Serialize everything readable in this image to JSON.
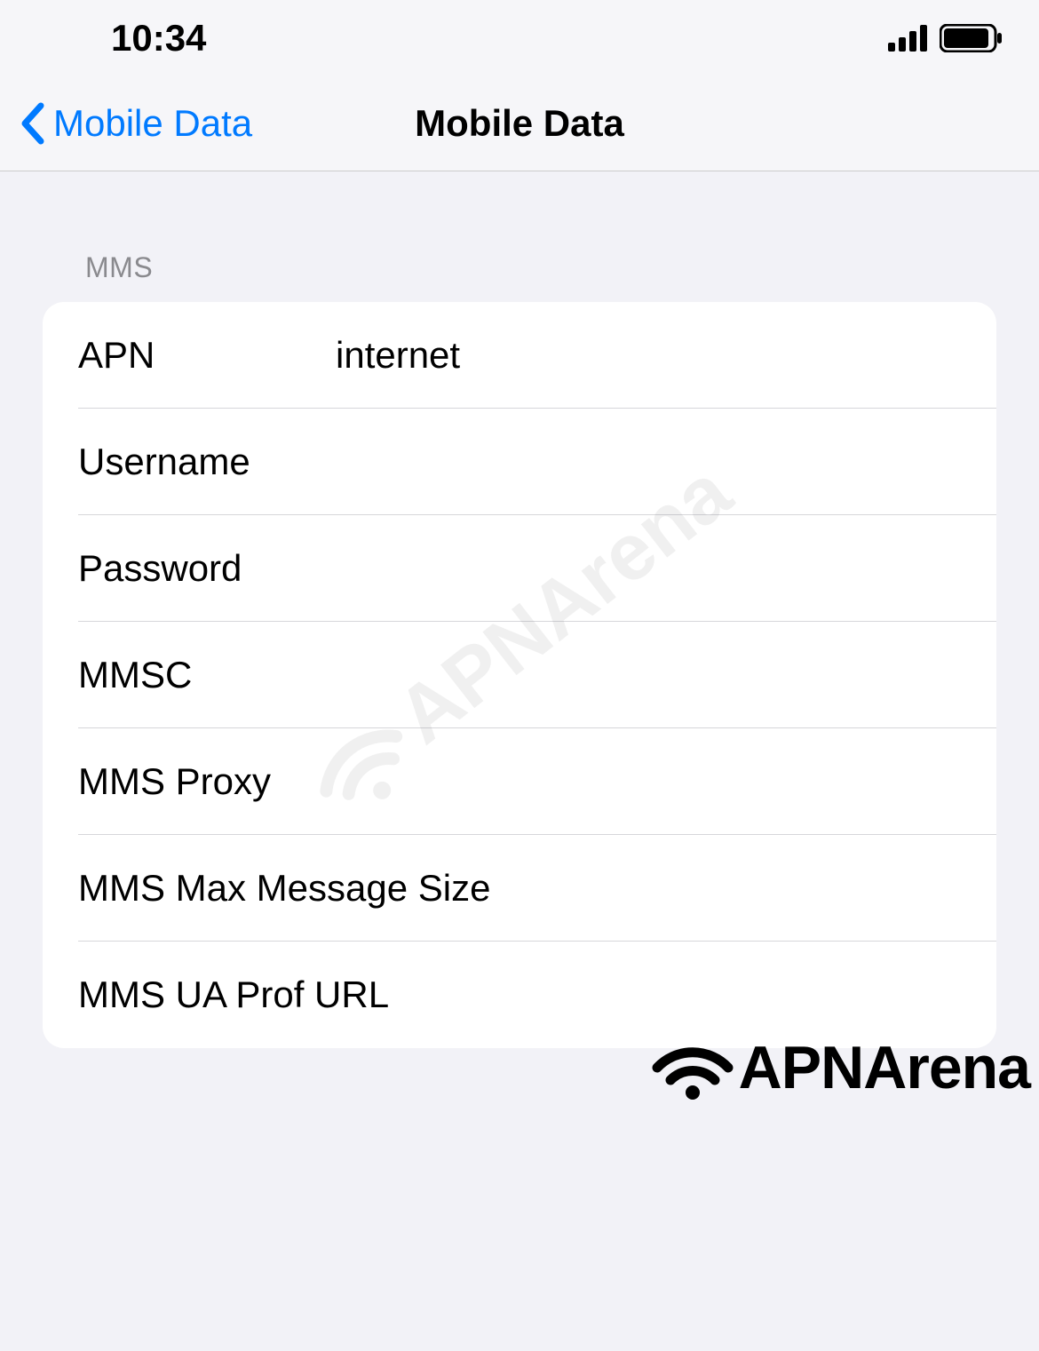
{
  "status": {
    "time": "10:34"
  },
  "nav": {
    "back_label": "Mobile Data",
    "title": "Mobile Data"
  },
  "section": {
    "header": "MMS",
    "rows": [
      {
        "label": "APN",
        "value": "internet"
      },
      {
        "label": "Username",
        "value": ""
      },
      {
        "label": "Password",
        "value": ""
      },
      {
        "label": "MMSC",
        "value": ""
      },
      {
        "label": "MMS Proxy",
        "value": ""
      },
      {
        "label": "MMS Max Message Size",
        "value": ""
      },
      {
        "label": "MMS UA Prof URL",
        "value": ""
      }
    ]
  },
  "watermark": {
    "text": "APNArena"
  }
}
